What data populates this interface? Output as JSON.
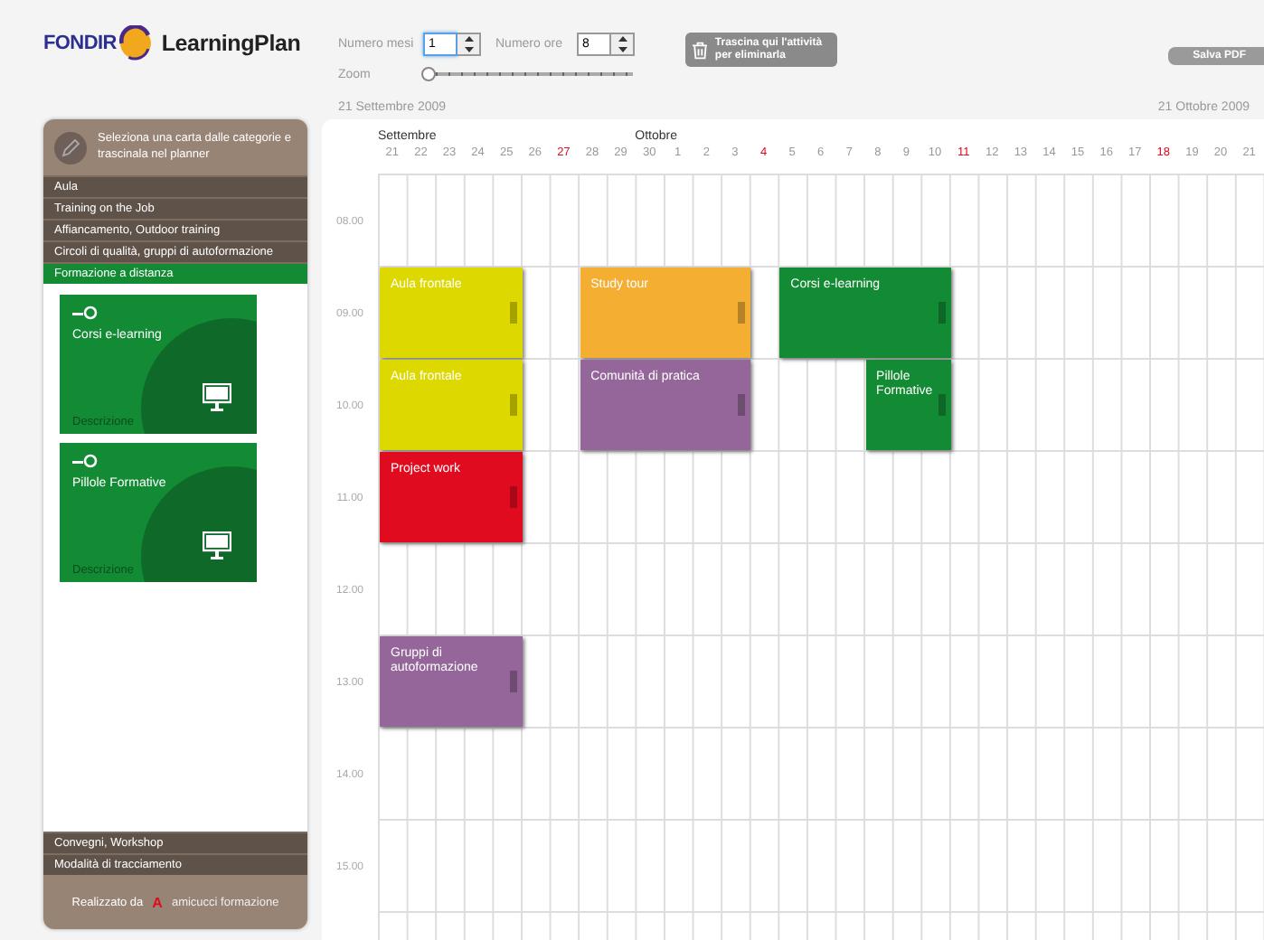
{
  "header": {
    "logo": "FONDIR",
    "app_title": "LearningPlan",
    "spinners": [
      {
        "label": "Numero mesi",
        "value": "1",
        "focused": true
      },
      {
        "label": "Numero ore",
        "value": "8",
        "focused": false
      }
    ],
    "zoom": {
      "label": "Zoom",
      "level": 0
    },
    "trash_button": "Trascina qui l'attività per eliminarla",
    "pdf_button": "Salva PDF"
  },
  "range": {
    "start": "21 Settembre 2009",
    "end": "21 Ottobre 2009"
  },
  "sidebar": {
    "instruction": "Seleziona una carta dalle categorie e trascinala nel planner",
    "categories": [
      {
        "label": "Aula",
        "selected": false
      },
      {
        "label": "Training on the Job",
        "selected": false
      },
      {
        "label": "Affiancamento, Outdoor training",
        "selected": false
      },
      {
        "label": "Circoli di qualità, gruppi di autoformazione",
        "selected": false
      },
      {
        "label": "Formazione a distanza",
        "selected": true
      }
    ],
    "cards": [
      {
        "title": "Corsi e-learning",
        "caption": "Descrizione"
      },
      {
        "title": "Pillole Formative",
        "caption": "Descrizione"
      }
    ],
    "more_categories": [
      {
        "label": "Convegni, Workshop",
        "selected": false
      },
      {
        "label": "Modalità di tracciamento",
        "selected": false
      }
    ],
    "credit": {
      "label": "Realizzato da",
      "brand_mark": "A",
      "brand": "amicucci formazione"
    }
  },
  "planner": {
    "days": [
      {
        "label": "21",
        "month": "Settembre",
        "holiday": false
      },
      {
        "label": "22",
        "holiday": false
      },
      {
        "label": "23",
        "holiday": false
      },
      {
        "label": "24",
        "holiday": false
      },
      {
        "label": "25",
        "holiday": false
      },
      {
        "label": "26",
        "holiday": false
      },
      {
        "label": "27",
        "holiday": true
      },
      {
        "label": "28",
        "holiday": false
      },
      {
        "label": "29",
        "holiday": false
      },
      {
        "label": "30",
        "month": "Ottobre",
        "holiday": false
      },
      {
        "label": "1",
        "holiday": false
      },
      {
        "label": "2",
        "holiday": false
      },
      {
        "label": "3",
        "holiday": false
      },
      {
        "label": "4",
        "holiday": true
      },
      {
        "label": "5",
        "holiday": false
      },
      {
        "label": "6",
        "holiday": false
      },
      {
        "label": "7",
        "holiday": false
      },
      {
        "label": "8",
        "holiday": false
      },
      {
        "label": "9",
        "holiday": false
      },
      {
        "label": "10",
        "holiday": false
      },
      {
        "label": "11",
        "holiday": true
      },
      {
        "label": "12",
        "holiday": false
      },
      {
        "label": "13",
        "holiday": false
      },
      {
        "label": "14",
        "holiday": false
      },
      {
        "label": "15",
        "holiday": false
      },
      {
        "label": "16",
        "holiday": false
      },
      {
        "label": "17",
        "holiday": false
      },
      {
        "label": "18",
        "holiday": true
      },
      {
        "label": "19",
        "holiday": false
      },
      {
        "label": "20",
        "holiday": false
      },
      {
        "label": "21",
        "holiday": false
      }
    ],
    "hours": [
      {
        "label": "08.00"
      },
      {
        "label": "09.00",
        "slots": [
          {
            "kind": "start",
            "title": "Aula frontale",
            "color": "#dcd800"
          },
          {
            "kind": "more"
          },
          {
            "kind": "more"
          },
          {
            "kind": "more"
          },
          {
            "kind": "more"
          },
          {
            "kind": "free"
          },
          {
            "kind": "free"
          },
          {
            "kind": "start",
            "title": "Study tour",
            "color": "#f4ae32"
          },
          {
            "kind": "more"
          },
          {
            "kind": "more"
          },
          {
            "kind": "more"
          },
          {
            "kind": "more"
          },
          {
            "kind": "more"
          },
          {
            "kind": "free"
          },
          {
            "kind": "start",
            "title": "Corsi e-learning",
            "color": "#138a34"
          },
          {
            "kind": "more"
          },
          {
            "kind": "more"
          },
          {
            "kind": "more"
          },
          {
            "kind": "more"
          },
          {
            "kind": "more"
          }
        ]
      },
      {
        "label": "10.00",
        "slots": [
          {
            "kind": "start",
            "title": "Aula frontale",
            "color": "#dcd800"
          },
          {
            "kind": "more"
          },
          {
            "kind": "more"
          },
          {
            "kind": "more"
          },
          {
            "kind": "more"
          },
          {
            "kind": "free"
          },
          {
            "kind": "free"
          },
          {
            "kind": "start",
            "title": "Comunità di pratica",
            "color": "#956699"
          },
          {
            "kind": "more"
          },
          {
            "kind": "more"
          },
          {
            "kind": "more"
          },
          {
            "kind": "more"
          },
          {
            "kind": "more"
          },
          {
            "kind": "free"
          },
          {
            "kind": "free"
          },
          {
            "kind": "free"
          },
          {
            "kind": "free"
          },
          {
            "kind": "start",
            "title": "Pillole Formative",
            "color": "#138a34"
          },
          {
            "kind": "more"
          },
          {
            "kind": "more"
          }
        ]
      },
      {
        "label": "11.00",
        "slots": [
          {
            "kind": "start",
            "title": "Project work",
            "color": "#e00b1f"
          },
          {
            "kind": "more"
          },
          {
            "kind": "more"
          },
          {
            "kind": "more"
          },
          {
            "kind": "more"
          }
        ]
      },
      {
        "label": "12.00"
      },
      {
        "label": "13.00",
        "slots": [
          {
            "kind": "start",
            "title": "Gruppi di autoformazione",
            "color": "#956699"
          },
          {
            "kind": "more"
          },
          {
            "kind": "more"
          },
          {
            "kind": "more"
          },
          {
            "kind": "more"
          }
        ]
      },
      {
        "label": "14.00"
      },
      {
        "label": "15.00"
      }
    ]
  }
}
